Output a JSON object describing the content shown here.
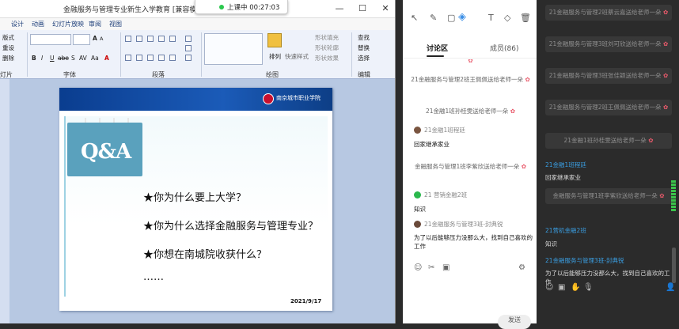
{
  "ppt": {
    "title": "金融服务与管理专业新生入学教育 [兼容模式]",
    "tabs": [
      "设计",
      "动画",
      "幻灯片放映",
      "审阅",
      "视图"
    ],
    "groups": {
      "slides": "灯片",
      "font": "字体",
      "paragraph": "段落",
      "drawing": "绘图",
      "editing": "编辑"
    },
    "slides_buttons": {
      "layout": "版式",
      "reset": "重设",
      "delete": "删除"
    },
    "drawing_buttons": {
      "arrange": "排列",
      "quick_styles": "快速样式",
      "fill": "形状填充",
      "outline": "形状轮廓",
      "effects": "形状效果"
    },
    "editing_buttons": {
      "find": "查找",
      "replace": "替换",
      "select": "选择"
    },
    "font_buttons": [
      "B",
      "I",
      "U",
      "abe",
      "S",
      "AV",
      "Aa",
      "A"
    ],
    "font_size_buttons": [
      "A",
      "A"
    ]
  },
  "live": {
    "status": "上课中 00:27:03"
  },
  "slide": {
    "qa": "Q&A",
    "school": "南京城市职业学院",
    "questions": [
      "★你为什么要上大学？",
      "★你为什么选择金融服务与管理专业？",
      "★你想在南城院收获什么？",
      "……"
    ],
    "date": "2021/9/17"
  },
  "chat": {
    "tabs": {
      "discussion": "讨论区",
      "members": "成员(86)"
    },
    "messages": [
      {
        "type": "system",
        "text": "21金融服务与管理2班王佩佩送给老师一朵"
      },
      {
        "type": "system",
        "text": "21金融1班孙桂雯送给老师一朵"
      },
      {
        "type": "user",
        "sender": "21金融1班程廷",
        "text": "回家继承家业"
      },
      {
        "type": "system",
        "text": "金融服务与管理1班李紫欣送给老师一朵"
      },
      {
        "type": "user",
        "sender": "21 营销金融2班",
        "text": "知识"
      },
      {
        "type": "user",
        "sender": "21金融服务与管理3班-封典锐",
        "text": "为了以后能够压力没那么大，找到自己喜欢的工作"
      }
    ],
    "send": "发送"
  },
  "right": {
    "messages": [
      {
        "type": "system",
        "text": "21金融服务与管理2班蔡云嘉送给老师一朵"
      },
      {
        "type": "system",
        "text": "21金融服务与管理3班刘可欣送给老师一朵"
      },
      {
        "type": "system",
        "text": "21金融服务与管理3班张佳颖送给老师一朵"
      },
      {
        "type": "system",
        "text": "21金融服务与管理2班王佩佩送给老师一朵"
      },
      {
        "type": "system",
        "text": "21金融1班孙桂雯送给老师一朵"
      },
      {
        "type": "user",
        "sender": "21金融1班程廷",
        "text": "回家继承家业"
      },
      {
        "type": "system",
        "text": "金融服务与管理1班李紫欣送给老师一朵"
      },
      {
        "type": "user",
        "sender": "21营机金融2班",
        "text": "知识"
      },
      {
        "type": "user",
        "sender": "21金融服务与管理3班-封典锐",
        "text": "为了以后能够压力没那么大，找到自己喜欢的工作"
      }
    ]
  },
  "icons": {
    "flower": "✿",
    "minimize": "—",
    "maximize": "☐",
    "close": "✕"
  }
}
